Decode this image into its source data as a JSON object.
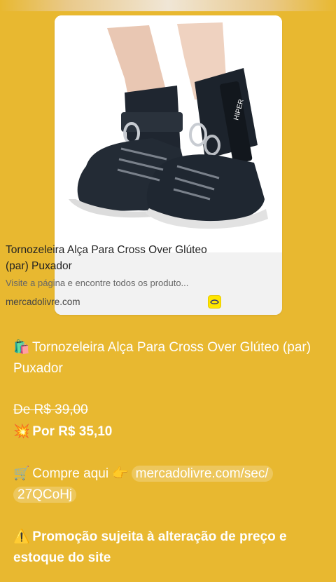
{
  "link_preview": {
    "title": "Tornozeleira Alça Para Cross Over Glúteo (par) Puxador",
    "description": "Visite a página e encontre todos os produto...",
    "domain": "mercadolivre.com",
    "image_alt": "Tornozeleira Alça Para Cross Over Glúteo (par) Puxador"
  },
  "message": {
    "title_emoji": "🛍️",
    "title": "Tornozeleira Alça Para Cross Over Glúteo (par) Puxador",
    "old_price": "De R$ 39,00",
    "new_price_emoji": "💥",
    "new_price": "Por R$ 35,10",
    "buy_emoji": "🛒",
    "buy_label": "Compre aqui",
    "point_emoji": "👉",
    "link_part1": "mercadolivre.com/sec/",
    "link_part2": "27QCoHj",
    "warning_emoji": "⚠️",
    "warning": "Promoção sujeita à alteração de preço e estoque do site"
  },
  "colors": {
    "background": "#e8b830",
    "text": "#ffffff",
    "card": "#ffffff",
    "card_body": "#f2f2f2"
  }
}
